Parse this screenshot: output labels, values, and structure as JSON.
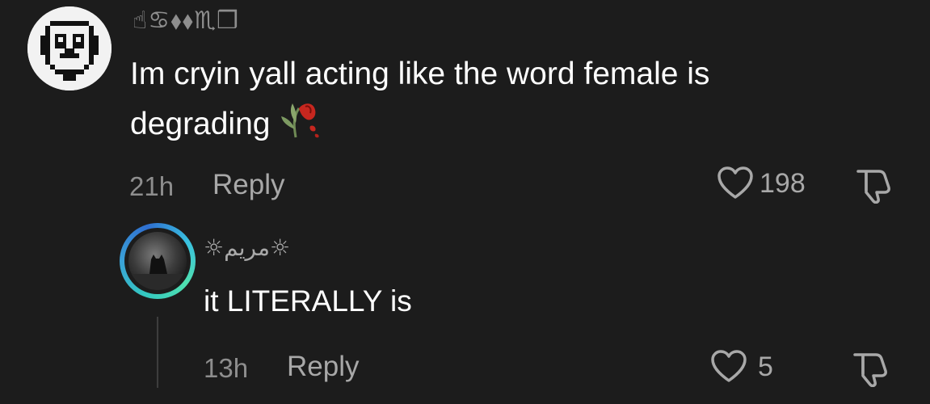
{
  "main_comment": {
    "username": "☝︎♋︎⬧︎⬧︎♏︎❒︎",
    "text": "Im cryin yall acting like the word female is degrading",
    "emoji": "wilted-rose-emoji",
    "time": "21h",
    "reply_label": "Reply",
    "like_count": "198"
  },
  "reply_comment": {
    "username": "☼︎مريم☼︎",
    "text": "it LITERALLY is",
    "time": "13h",
    "reply_label": "Reply",
    "like_count": "5"
  },
  "colors": {
    "background": "#1c1c1c",
    "text_primary": "#ffffff",
    "text_secondary": "#8e8e8e",
    "avatar_ring_accent": "#3aa0d8"
  },
  "icons": [
    "heart-outline-icon",
    "thumbs-down-outline-icon"
  ]
}
